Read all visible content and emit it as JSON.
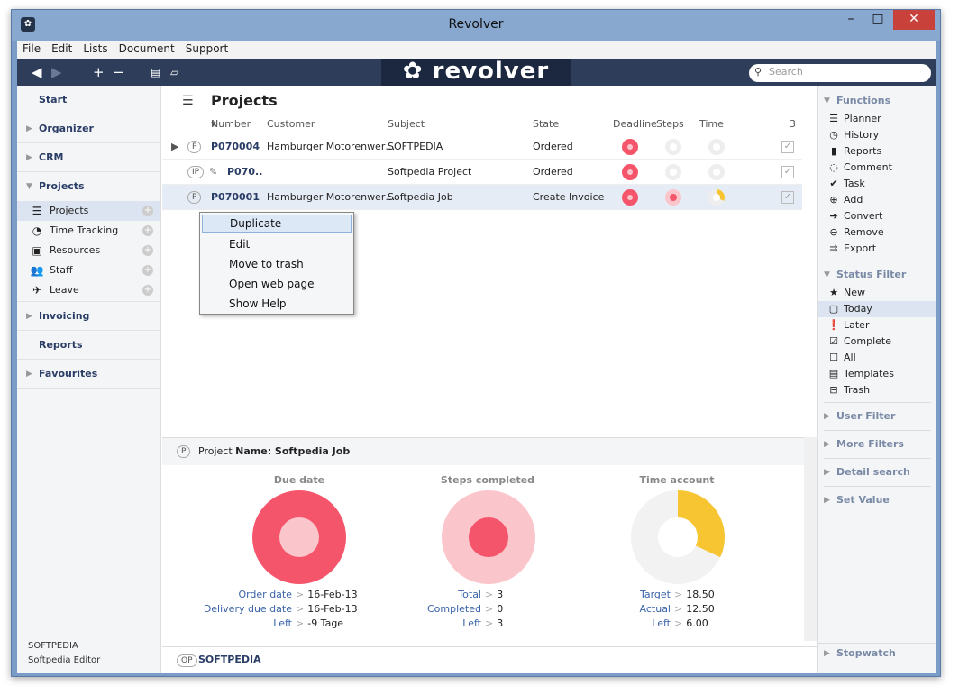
{
  "window": {
    "title": "Revolver"
  },
  "menu": [
    "File",
    "Edit",
    "Lists",
    "Document",
    "Support"
  ],
  "toolbar": {
    "logo": "revolver",
    "search_placeholder": "Search"
  },
  "left_nav": {
    "start": "Start",
    "organizer": "Organizer",
    "crm": "CRM",
    "projects": "Projects",
    "project_items": [
      "Projects",
      "Time Tracking",
      "Resources",
      "Staff",
      "Leave"
    ],
    "invoicing": "Invoicing",
    "reports": "Reports",
    "favourites": "Favourites",
    "footer_company": "SOFTPEDIA",
    "footer_user": "Softpedia Editor"
  },
  "projects": {
    "title": "Projects",
    "count": "3",
    "columns": {
      "number": "Number",
      "customer": "Customer",
      "subject": "Subject",
      "state": "State",
      "deadline": "Deadline",
      "steps": "Steps",
      "time": "Time"
    },
    "rows": [
      {
        "badge": "P",
        "number": "P070004",
        "customer": "Hamburger Motorenwer…",
        "subject": "SOFTPEDIA",
        "state": "Ordered"
      },
      {
        "badge": "IP",
        "number": "P070..",
        "customer": "",
        "subject": "Softpedia Project",
        "state": "Ordered"
      },
      {
        "badge": "P",
        "number": "P070001",
        "customer": "Hamburger Motorenwer…",
        "subject": "Softpedia Job",
        "state": "Create Invoice"
      }
    ]
  },
  "context_menu": [
    "Duplicate",
    "Edit",
    "Move to trash",
    "Open web page",
    "Show Help"
  ],
  "detail": {
    "badge": "P",
    "label": "Project",
    "name": "Name: Softpedia Job",
    "due_title": "Due date",
    "steps_title": "Steps completed",
    "time_title": "Time account",
    "due": [
      {
        "k": "Order date",
        "v": "16-Feb-13"
      },
      {
        "k": "Delivery due date",
        "v": "16-Feb-13"
      },
      {
        "k": "Left",
        "v": "-9 Tage"
      }
    ],
    "steps": [
      {
        "k": "Total",
        "v": "3"
      },
      {
        "k": "Completed",
        "v": "0"
      },
      {
        "k": "Left",
        "v": "3"
      }
    ],
    "time": [
      {
        "k": "Target",
        "v": "18.50"
      },
      {
        "k": "Actual",
        "v": "12.50"
      },
      {
        "k": "Left",
        "v": "6.00"
      }
    ],
    "time_fraction": 0.32
  },
  "bottom": {
    "badge": "OP",
    "name": "SOFTPEDIA"
  },
  "right_panel": {
    "functions": "Functions",
    "function_items": [
      "Planner",
      "History",
      "Reports",
      "Comment",
      "Task",
      "Add",
      "Convert",
      "Remove",
      "Export"
    ],
    "status_filter": "Status Filter",
    "status_items": [
      "New",
      "Today",
      "Later",
      "Complete",
      "All",
      "Templates",
      "Trash"
    ],
    "user_filter": "User Filter",
    "more_filters": "More Filters",
    "detail_search": "Detail search",
    "set_value": "Set Value",
    "stopwatch": "Stopwatch"
  },
  "colors": {
    "red": "#f5556b",
    "pink": "#fbc5cc",
    "yellow": "#f6c531",
    "navy": "#2d3d5a"
  }
}
